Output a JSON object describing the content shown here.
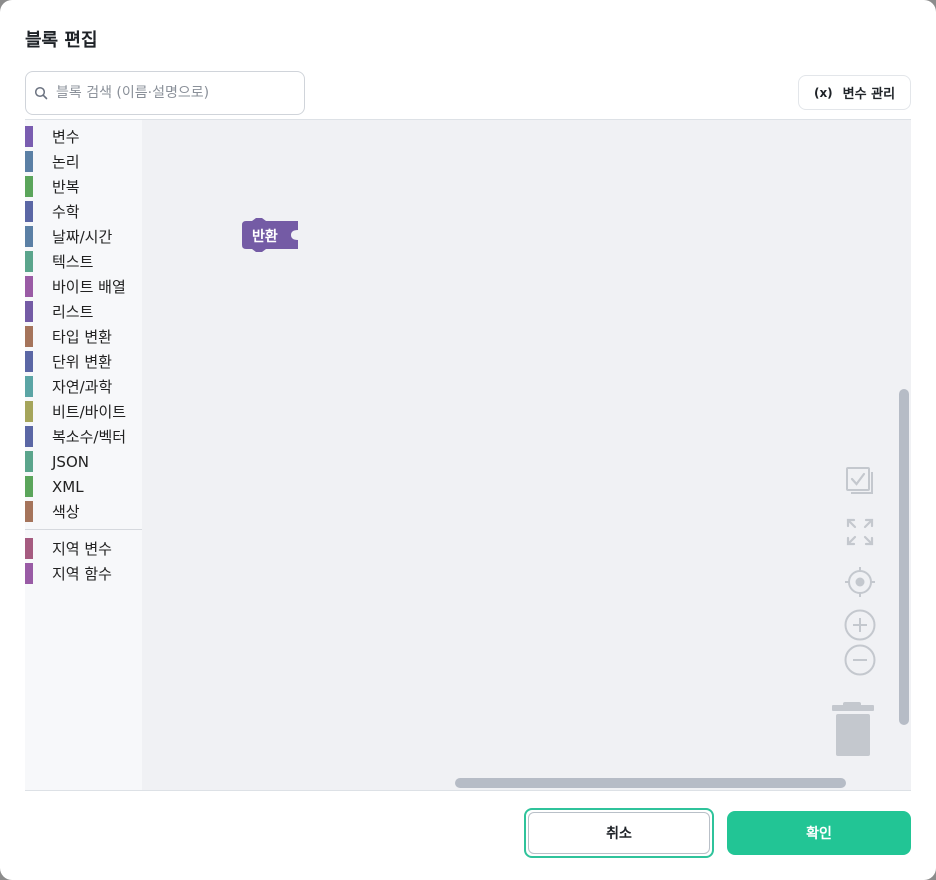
{
  "dialog": {
    "title": "블록 편집",
    "search_placeholder": "블록 검색 (이름·설명으로)",
    "variables_button": "변수 관리",
    "variables_icon_text": "(x)"
  },
  "toolbox": {
    "categories": [
      {
        "label": "변수",
        "color": "#7a5db0"
      },
      {
        "label": "논리",
        "color": "#5b80a5"
      },
      {
        "label": "반복",
        "color": "#5ba55b"
      },
      {
        "label": "수학",
        "color": "#5b67a5"
      },
      {
        "label": "날짜/시간",
        "color": "#5b80a5"
      },
      {
        "label": "텍스트",
        "color": "#5ba58c"
      },
      {
        "label": "바이트 배열",
        "color": "#9a5ba5"
      },
      {
        "label": "리스트",
        "color": "#745ba5"
      },
      {
        "label": "타입 변환",
        "color": "#a5745b"
      },
      {
        "label": "단위 변환",
        "color": "#5b67a5"
      },
      {
        "label": "자연/과학",
        "color": "#5ba5a5"
      },
      {
        "label": "비트/바이트",
        "color": "#a5a55b"
      },
      {
        "label": "복소수/벡터",
        "color": "#5b67a5"
      },
      {
        "label": "JSON",
        "color": "#5ba58c"
      },
      {
        "label": "XML",
        "color": "#5ba55b"
      },
      {
        "label": "색상",
        "color": "#a5745b"
      }
    ],
    "local_categories": [
      {
        "label": "지역 변수",
        "color": "#a55b80"
      },
      {
        "label": "지역 함수",
        "color": "#995ba5"
      }
    ]
  },
  "workspace": {
    "block": {
      "label": "반환",
      "color": "#745ba5"
    }
  },
  "footer": {
    "cancel_label": "취소",
    "ok_label": "확인",
    "accent": "#22c595"
  }
}
